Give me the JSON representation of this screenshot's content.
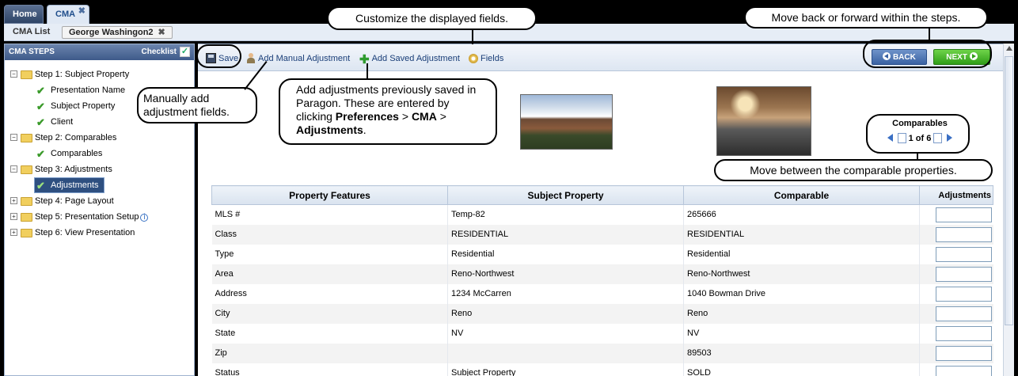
{
  "tabs": {
    "home": "Home",
    "cma": "CMA"
  },
  "subnav": {
    "list_link": "CMA List",
    "open_record": "George Washingon2"
  },
  "sidebar": {
    "title": "CMA STEPS",
    "checklist_label": "Checklist",
    "steps": [
      {
        "label": "Step 1: Subject Property",
        "children": [
          "Presentation Name",
          "Subject Property",
          "Client"
        ]
      },
      {
        "label": "Step 2: Comparables",
        "children": [
          "Comparables"
        ]
      },
      {
        "label": "Step 3: Adjustments",
        "children": [
          "Adjustments"
        ]
      },
      {
        "label": "Step 4: Page Layout"
      },
      {
        "label": "Step 5: Presentation Setup"
      },
      {
        "label": "Step 6: View Presentation"
      }
    ]
  },
  "toolbar": {
    "save": "Save",
    "add_manual": "Add Manual Adjustment",
    "add_saved": "Add Saved Adjustment",
    "fields": "Fields",
    "back": "BACK",
    "next": "NEXT"
  },
  "comparables": {
    "title": "Comparables",
    "pager": "1 of 6"
  },
  "table": {
    "headers": [
      "Property Features",
      "Subject Property",
      "Comparable",
      "Adjustments"
    ],
    "rows": [
      [
        "MLS #",
        "Temp-82",
        "265666"
      ],
      [
        "Class",
        "RESIDENTIAL",
        "RESIDENTIAL"
      ],
      [
        "Type",
        "Residential",
        "Residential"
      ],
      [
        "Area",
        "Reno-Northwest",
        "Reno-Northwest"
      ],
      [
        "Address",
        "1234 McCarren",
        "1040 Bowman Drive"
      ],
      [
        "City",
        "Reno",
        "Reno"
      ],
      [
        "State",
        "NV",
        "NV"
      ],
      [
        "Zip",
        "",
        "89503"
      ],
      [
        "Status",
        "Subject Property",
        "SOLD"
      ]
    ]
  },
  "callouts": {
    "fields": "Customize the displayed fields.",
    "steps": "Move back or forward within the steps.",
    "manual": "Manually add adjustment fields.",
    "saved_prefix": "Add adjustments previously saved in Paragon.  These are entered by clicking ",
    "saved_pref": "Preferences",
    "saved_sep": " > ",
    "saved_cma": "CMA",
    "saved_sep2": " > ",
    "saved_adj": "Adjustments",
    "saved_end": ".",
    "move": "Move between the comparable properties."
  }
}
